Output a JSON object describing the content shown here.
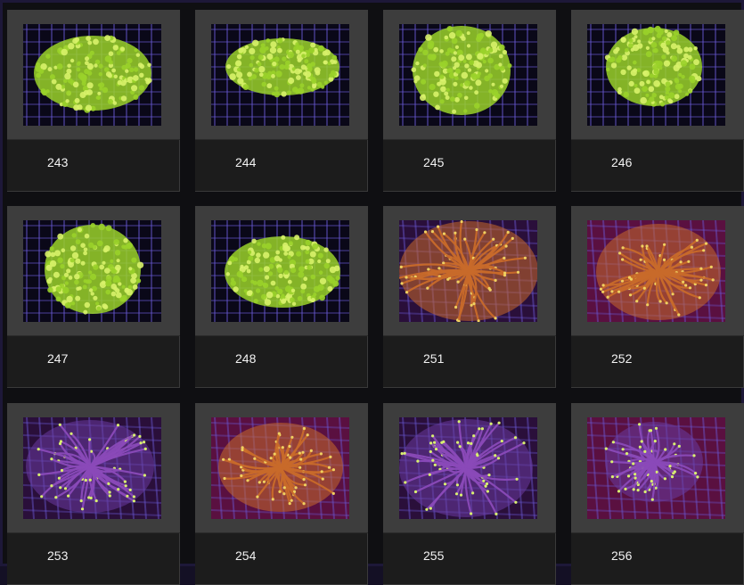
{
  "gallery": {
    "items": [
      {
        "label": "243",
        "coral": "green"
      },
      {
        "label": "244",
        "coral": "green"
      },
      {
        "label": "245",
        "coral": "green"
      },
      {
        "label": "246",
        "coral": "green"
      },
      {
        "label": "247",
        "coral": "green"
      },
      {
        "label": "248",
        "coral": "green"
      },
      {
        "label": "251",
        "coral": "orange"
      },
      {
        "label": "252",
        "coral": "orange"
      },
      {
        "label": "253",
        "coral": "purple"
      },
      {
        "label": "254",
        "coral": "orange"
      },
      {
        "label": "255",
        "coral": "purple"
      },
      {
        "label": "256",
        "coral": "purple"
      }
    ]
  },
  "colors": {
    "green": "#9ad12a",
    "green_tip": "#d8f26a",
    "orange": "#c86a2a",
    "orange_tip": "#f0d060",
    "purple": "#6a3aa0",
    "purple_tip": "#d8f070",
    "rack": "#6a5ad8",
    "bg_violet": "#2a0f3a",
    "bg_magenta": "#5a1040"
  }
}
